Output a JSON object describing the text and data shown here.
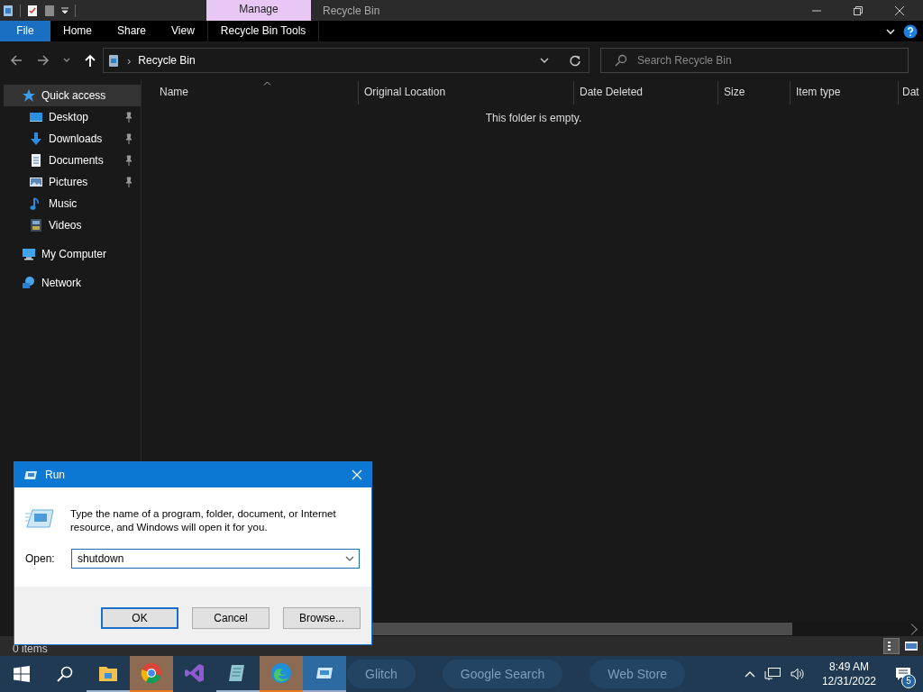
{
  "window": {
    "title": "Recycle Bin",
    "context_tab": "Manage"
  },
  "ribbon_tabs": [
    {
      "label": "File",
      "kind": "file"
    },
    {
      "label": "Home",
      "kind": "tab"
    },
    {
      "label": "Share",
      "kind": "tab"
    },
    {
      "label": "View",
      "kind": "tab"
    },
    {
      "label": "Recycle Bin Tools",
      "kind": "context"
    }
  ],
  "address": {
    "separator": "›",
    "path": "Recycle Bin"
  },
  "search": {
    "placeholder": "Search Recycle Bin"
  },
  "sidebar": {
    "items": [
      {
        "label": "Quick access",
        "kind": "star",
        "selected": true,
        "children": [
          {
            "label": "Desktop",
            "kind": "desktop",
            "pinned": true,
            "selected": false
          },
          {
            "label": "Downloads",
            "kind": "download",
            "pinned": true,
            "selected": false
          },
          {
            "label": "Documents",
            "kind": "document",
            "pinned": true,
            "selected": false
          },
          {
            "label": "Pictures",
            "kind": "pictures",
            "pinned": true,
            "selected": false
          },
          {
            "label": "Music",
            "kind": "music",
            "pinned": false,
            "selected": false
          },
          {
            "label": "Videos",
            "kind": "videos",
            "pinned": false,
            "selected": false
          }
        ]
      },
      {
        "label": "My Computer",
        "kind": "computer",
        "selected": false
      },
      {
        "label": "Network",
        "kind": "network",
        "selected": false
      }
    ]
  },
  "table": {
    "columns": [
      {
        "label": "Name",
        "sorted": true
      },
      {
        "label": "Original Location",
        "sorted": false
      },
      {
        "label": "Date Deleted",
        "sorted": false
      },
      {
        "label": "Size",
        "sorted": false
      },
      {
        "label": "Item type",
        "sorted": false
      },
      {
        "label": "Dat",
        "sorted": false
      }
    ],
    "empty_message": "This folder is empty."
  },
  "status_bar": {
    "text": "0 items"
  },
  "run_dialog": {
    "title": "Run",
    "description": "Type the name of a program, folder, document, or Internet resource, and Windows will open it for you.",
    "open_label": "Open:",
    "value": "shutdown",
    "buttons": [
      {
        "label": "OK",
        "default": true
      },
      {
        "label": "Cancel",
        "default": false
      },
      {
        "label": "Browse...",
        "default": false
      }
    ]
  },
  "taskbar": {
    "apps": [
      {
        "kind": "explorer",
        "running": true,
        "flashing": false,
        "active": false
      },
      {
        "kind": "chrome",
        "running": true,
        "flashing": true,
        "active": false
      },
      {
        "kind": "studio",
        "running": false,
        "flashing": false,
        "active": false
      },
      {
        "kind": "notepad",
        "running": true,
        "flashing": false,
        "active": false
      },
      {
        "kind": "edge",
        "running": true,
        "flashing": true,
        "active": false
      },
      {
        "kind": "run",
        "running": true,
        "flashing": false,
        "active": true
      }
    ],
    "background_labels": [
      "Glitch",
      "Google Search",
      "Web Store"
    ],
    "time": "8:49 AM",
    "date": "12/31/2022",
    "notification_count": "5"
  }
}
